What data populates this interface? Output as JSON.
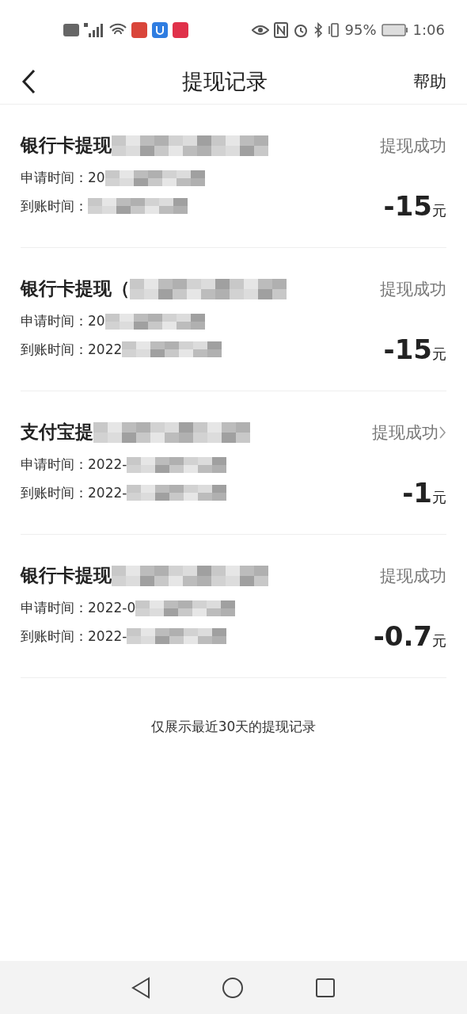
{
  "status_bar": {
    "battery": "95%",
    "time": "1:06"
  },
  "header": {
    "title": "提现记录",
    "help": "帮助"
  },
  "records": [
    {
      "title": "银行卡提现",
      "status": "提现成功",
      "arrow": false,
      "applied": "申请时间：20",
      "arrived": "到账时间：",
      "amount": "-15",
      "unit": "元"
    },
    {
      "title": "银行卡提现（",
      "status": "提现成功",
      "arrow": false,
      "applied": "申请时间：20",
      "arrived": "到账时间：2022",
      "amount": "-15",
      "unit": "元"
    },
    {
      "title": "支付宝提",
      "status": "提现成功",
      "arrow": true,
      "applied": "申请时间：2022-",
      "arrived": "到账时间：2022-",
      "amount": "-1",
      "unit": "元"
    },
    {
      "title": "银行卡提现",
      "status": "提现成功",
      "arrow": false,
      "applied": "申请时间：2022-0",
      "arrived": "到账时间：2022-",
      "amount": "-0.7",
      "unit": "元"
    }
  ],
  "footer_note": "仅展示最近30天的提现记录"
}
